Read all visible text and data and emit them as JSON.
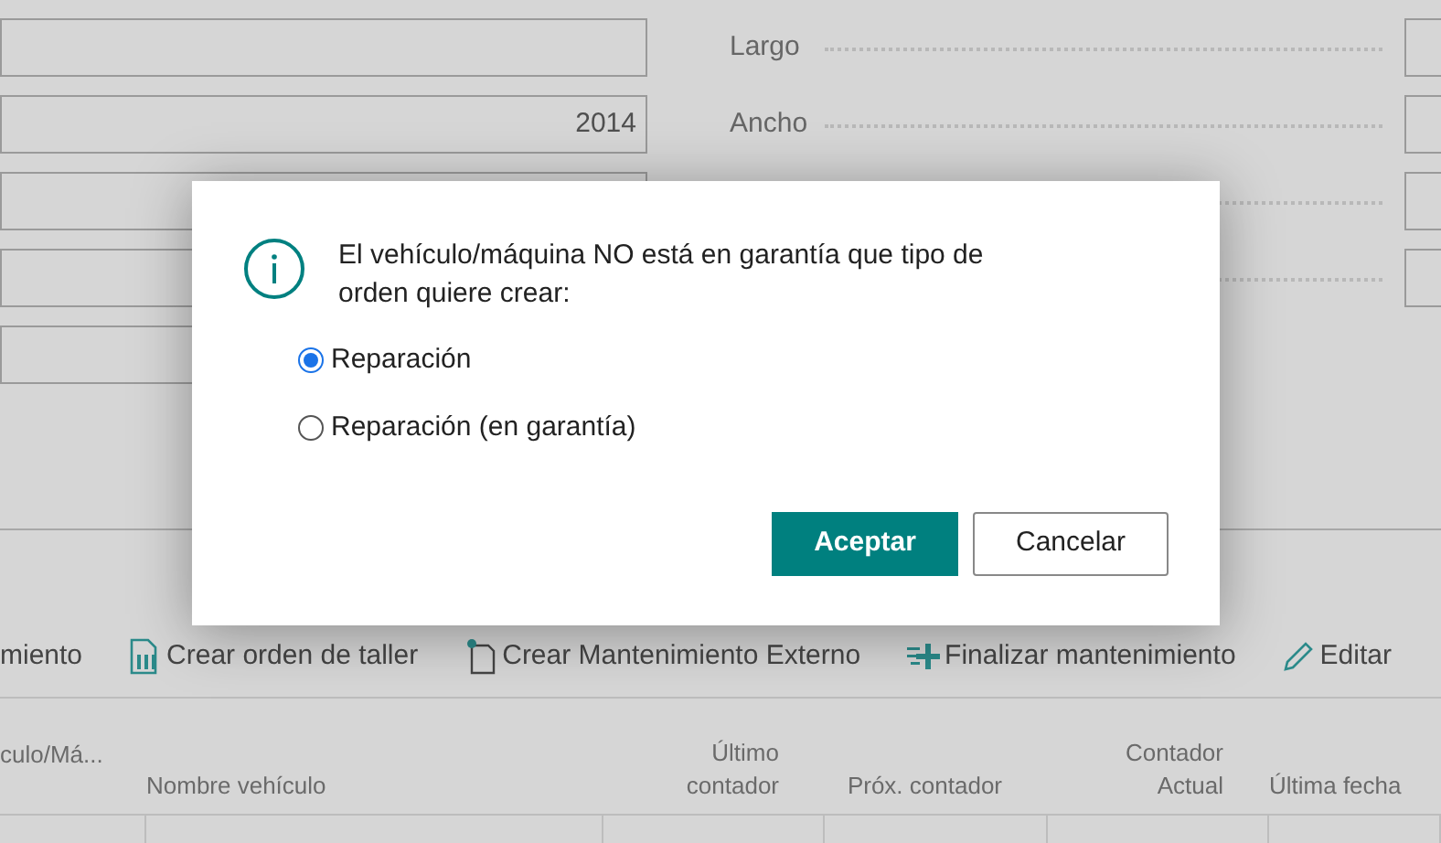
{
  "form": {
    "year_field": {
      "value": "2014"
    },
    "right_fields": [
      {
        "label": "Largo"
      },
      {
        "label": "Ancho"
      }
    ]
  },
  "toolbar": [
    {
      "label": "miento"
    },
    {
      "label": "Crear orden de taller"
    },
    {
      "label": "Crear Mantenimiento Externo"
    },
    {
      "label": "Finalizar mantenimiento"
    },
    {
      "label": "Editar"
    }
  ],
  "table": {
    "columns": [
      {
        "label": "culo/Má..."
      },
      {
        "label": "Nombre vehículo"
      },
      {
        "label": "Último contador"
      },
      {
        "label": "Próx. contador"
      },
      {
        "label": "Contador Actual"
      },
      {
        "label": "Última fecha"
      }
    ]
  },
  "dialog": {
    "message": "El vehículo/máquina NO está en garantía que tipo de orden quiere crear:",
    "options": [
      {
        "label": "Reparación",
        "selected": true
      },
      {
        "label": "Reparación (en garantía)",
        "selected": false
      }
    ],
    "buttons": [
      {
        "label": "Aceptar",
        "kind": "primary"
      },
      {
        "label": "Cancelar",
        "kind": "secondary"
      }
    ]
  }
}
